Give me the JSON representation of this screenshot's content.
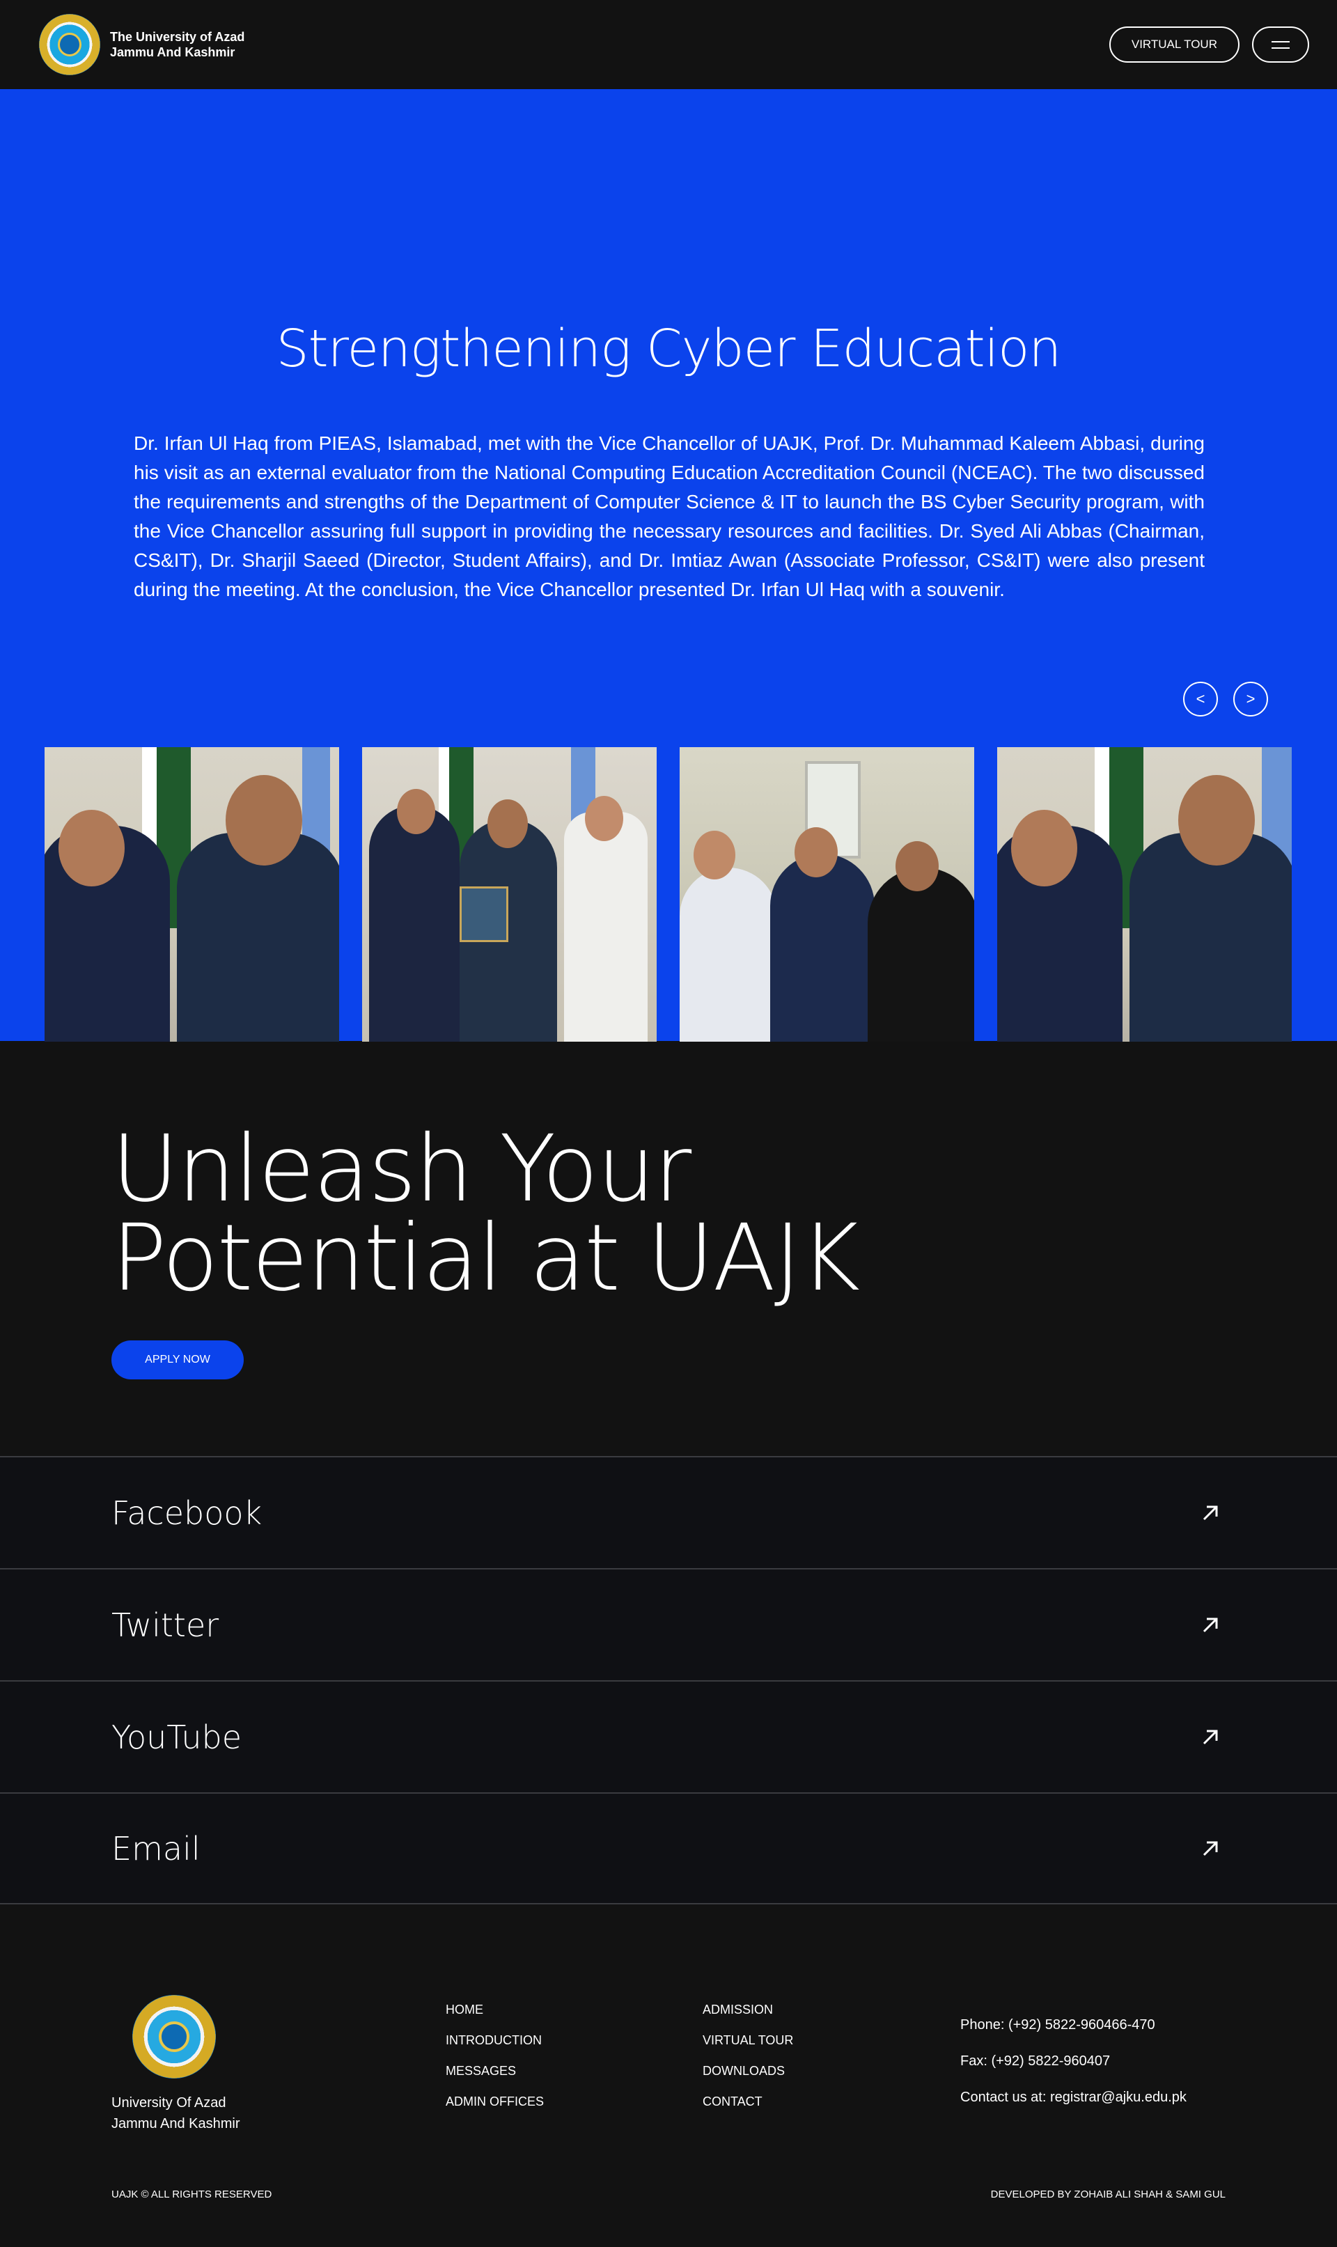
{
  "header": {
    "brand_line1": "The University of Azad",
    "brand_line2": "Jammu And Kashmir",
    "virtual_tour_label": "VIRTUAL TOUR"
  },
  "hero": {
    "title": "Strengthening Cyber Education",
    "body": "Dr. Irfan Ul Haq from PIEAS, Islamabad, met with the Vice Chancellor of UAJK, Prof. Dr. Muhammad Kaleem Abbasi, during his visit as an external evaluator from the National Computing Education Accreditation Council (NCEAC). The two discussed the requirements and strengths of the Department of Computer Science & IT to launch the BS Cyber Security program, with the Vice Chancellor assuring full support in providing the necessary resources and facilities. Dr. Syed Ali Abbas (Chairman, CS&IT), Dr. Sharjil Saeed (Director, Student Affairs), and Dr. Imtiaz Awan (Associate Professor, CS&IT) were also present during the meeting. At the conclusion, the Vice Chancellor presented Dr. Irfan Ul Haq with a souvenir.",
    "prev_label": "<",
    "next_label": ">"
  },
  "cta": {
    "title_line1": "Unleash Your",
    "title_line2": "Potential at UAJK",
    "apply_label": "APPLY NOW"
  },
  "social": {
    "items": [
      {
        "label": "Facebook"
      },
      {
        "label": "Twitter"
      },
      {
        "label": "YouTube"
      },
      {
        "label": "Email"
      }
    ]
  },
  "footer": {
    "name_line1": "University Of Azad",
    "name_line2": "Jammu And Kashmir",
    "col1": [
      "HOME",
      "INTRODUCTION",
      "MESSAGES",
      "ADMIN OFFICES"
    ],
    "col2": [
      "ADMISSION",
      "VIRTUAL TOUR",
      "DOWNLOADS",
      "CONTACT"
    ],
    "phone": "Phone: (+92) 5822-960466-470",
    "fax": "Fax: (+92) 5822-960407",
    "contact": "Contact us at: registrar@ajku.edu.pk",
    "copyright": "UAJK © ALL RIGHTS RESERVED",
    "developer": "DEVELOPED BY ZOHAIB ALI SHAH & SAMI GUL"
  },
  "colors": {
    "accent_blue": "#0b43ec",
    "background_dark": "#121212"
  }
}
